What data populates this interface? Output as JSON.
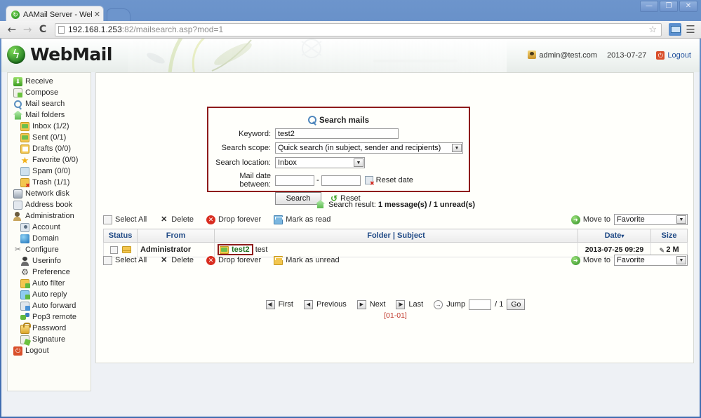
{
  "browser": {
    "tab_title": "AAMail Server - Webma",
    "tab_close": "✕",
    "url_host": "192.168.1.253",
    "url_rest": ":82/mailsearch.asp?mod=1",
    "back_icon": "←",
    "forward_icon": "→",
    "reload_icon": "C",
    "star_icon": "☆",
    "menu_icon": "☰",
    "win_minimize": "—",
    "win_maximize": "❐",
    "win_close": "✕"
  },
  "header": {
    "brand": "WebMail",
    "user_email": "admin@test.com",
    "date": "2013-07-27",
    "logout_label": "Logout"
  },
  "sidebar": {
    "items": [
      {
        "label": "Receive",
        "icon": "receive-icon",
        "indent": false
      },
      {
        "label": "Compose",
        "icon": "compose-icon",
        "indent": false
      },
      {
        "label": "Mail search",
        "icon": "search-icon",
        "indent": false
      },
      {
        "label": "Mail folders",
        "icon": "home-icon",
        "indent": false
      },
      {
        "label": "Inbox (1/2)",
        "icon": "folder-mail-icon",
        "indent": true
      },
      {
        "label": "Sent (0/1)",
        "icon": "folder-sent-icon",
        "indent": true
      },
      {
        "label": "Drafts (0/0)",
        "icon": "drafts-icon",
        "indent": true
      },
      {
        "label": "Favorite (0/0)",
        "icon": "star-icon",
        "indent": true
      },
      {
        "label": "Spam (0/0)",
        "icon": "spam-icon",
        "indent": true
      },
      {
        "label": "Trash (1/1)",
        "icon": "trash-icon",
        "indent": true
      },
      {
        "label": "Network disk",
        "icon": "disk-icon",
        "indent": false
      },
      {
        "label": "Address book",
        "icon": "book-icon",
        "indent": false
      },
      {
        "label": "Administration",
        "icon": "admin-icon",
        "indent": false
      },
      {
        "label": "Account",
        "icon": "account-icon",
        "indent": true
      },
      {
        "label": "Domain",
        "icon": "domain-icon",
        "indent": true
      },
      {
        "label": "Configure",
        "icon": "configure-icon",
        "indent": false
      },
      {
        "label": "Userinfo",
        "icon": "userinfo-icon",
        "indent": true
      },
      {
        "label": "Preference",
        "icon": "preference-icon",
        "indent": true
      },
      {
        "label": "Auto filter",
        "icon": "auto-filter-icon",
        "indent": true
      },
      {
        "label": "Auto reply",
        "icon": "auto-reply-icon",
        "indent": true
      },
      {
        "label": "Auto forward",
        "icon": "auto-forward-icon",
        "indent": true
      },
      {
        "label": "Pop3 remote",
        "icon": "pop3-icon",
        "indent": true
      },
      {
        "label": "Password",
        "icon": "lock-icon",
        "indent": true
      },
      {
        "label": "Signature",
        "icon": "signature-icon",
        "indent": true
      },
      {
        "label": "Logout",
        "icon": "logout-icon",
        "indent": false
      }
    ]
  },
  "search_panel": {
    "title": "Search mails",
    "keyword_label": "Keyword:",
    "keyword_value": "test2",
    "scope_label": "Search scope:",
    "scope_value": "Quick search (in subject, sender and recipients)",
    "location_label": "Search location:",
    "location_value": "Inbox",
    "date_label": "Mail date between:",
    "date_from": "",
    "date_to": "",
    "date_separator": "-",
    "reset_date_label": "Reset date",
    "search_button": "Search",
    "reset_label": "Reset",
    "border_color": "#8e1b1b"
  },
  "result": {
    "prefix": "Search result: ",
    "counts": "1 message(s) / 1 unread(s)"
  },
  "toolbar_top": {
    "select_all": "Select All",
    "delete": "Delete",
    "drop_forever": "Drop forever",
    "mark": "Mark as read",
    "move_to_label": "Move to",
    "move_to_value": "Favorite"
  },
  "toolbar_bottom": {
    "select_all": "Select All",
    "delete": "Delete",
    "drop_forever": "Drop forever",
    "mark": "Mark as unread",
    "move_to_label": "Move to",
    "move_to_value": "Favorite"
  },
  "table": {
    "headers": {
      "status": "Status",
      "from": "From",
      "subject": "Folder | Subject",
      "date": "Date",
      "date_sort": "▾",
      "size": "Size"
    },
    "rows": [
      {
        "from": "Administrator",
        "folder": "test2",
        "subject": "test",
        "date": "2013-07-25 09:29",
        "size": "2 M",
        "attachment_icon": "✎"
      }
    ]
  },
  "pager": {
    "first": "First",
    "previous": "Previous",
    "next": "Next",
    "last": "Last",
    "jump": "Jump",
    "jump_value": "",
    "total": "/ 1",
    "go": "Go",
    "range": "[01-01]",
    "range_color": "#c0392b"
  }
}
